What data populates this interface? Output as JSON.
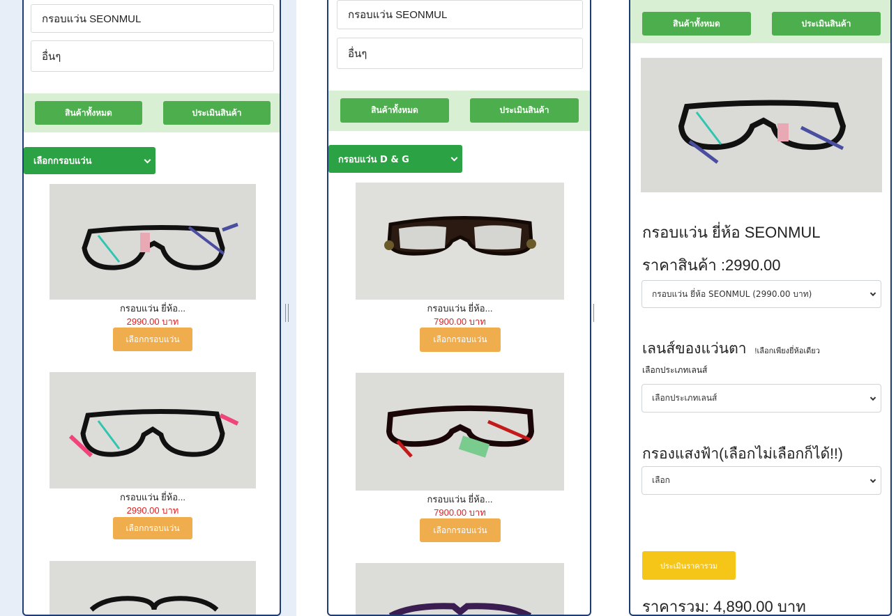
{
  "panel_left": {
    "filter_items": [
      "กรอบแว่น SEONMUL",
      "อื่นๆ"
    ],
    "nav": {
      "all_products": "สินค้าทั้งหมด",
      "evaluate": "ประเมินสินค้า"
    },
    "category_select": "เลือกกรอบแว่น",
    "products": [
      {
        "name": "กรอบแว่น ยี่ห้อ...",
        "price": "2990.00 บาท",
        "button": "เลือกกรอบแว่น",
        "icon": "eyeglasses-blue-temple-photo"
      },
      {
        "name": "กรอบแว่น ยี่ห้อ...",
        "price": "2990.00 บาท",
        "button": "เลือกกรอบแว่น",
        "icon": "eyeglasses-pink-temple-photo"
      },
      {
        "icon": "eyeglasses-round-photo"
      }
    ]
  },
  "panel_middle": {
    "filter_items": [
      "กรอบแว่น SEONMUL",
      "อื่นๆ"
    ],
    "nav": {
      "all_products": "สินค้าทั้งหมด",
      "evaluate": "ประเมินสินค้า"
    },
    "category_select": "กรอบแว่น D & G",
    "products": [
      {
        "name": "กรอบแว่น ยี่ห้อ...",
        "price": "7900.00 บาท",
        "button": "เลือกกรอบแว่น",
        "icon": "eyeglasses-dg-brown-photo"
      },
      {
        "name": "กรอบแว่น ยี่ห้อ...",
        "price": "7900.00 บาท",
        "button": "เลือกกรอบแว่น",
        "icon": "eyeglasses-dg-red-photo"
      },
      {
        "icon": "eyeglasses-purple-photo"
      }
    ]
  },
  "panel_right": {
    "nav": {
      "all_products": "สินค้าทั้งหมด",
      "evaluate": "ประเมินสินค้า"
    },
    "product_title": "กรอบแว่น ยี่ห้อ SEONMUL",
    "price_line": "ราคาสินค้า :2990.00",
    "frame_select": "กรอบแว่น ยี่ห้อ SEONMUL (2990.00 บาท)",
    "lens_heading": "เลนส์ของแว่นตา",
    "lens_note": "!เลือกเพียงยี่ห้อเดียว",
    "lens_type_label": "เลือกประเภทเลนส์",
    "lens_type_select": "เลือกประเภทเลนส์",
    "bluelight_heading": "กรองแสงฟ้า(เลือกไม่เลือกก็ได้!!)",
    "bluelight_select": "เลือก",
    "evaluate_total_button": "ประเมินราคารวม",
    "total_line": "ราคารวม: 4,890.00 บาท",
    "icon": "eyeglasses-blue-temple-photo"
  },
  "colors": {
    "green_button": "#4cae4c",
    "green_bar": "#d8efd3",
    "select_green": "#2ba243",
    "orange_button": "#f0ad4e",
    "yellow_button": "#f5c518",
    "price_red": "#e02020",
    "panel_border": "#1f3b73"
  }
}
